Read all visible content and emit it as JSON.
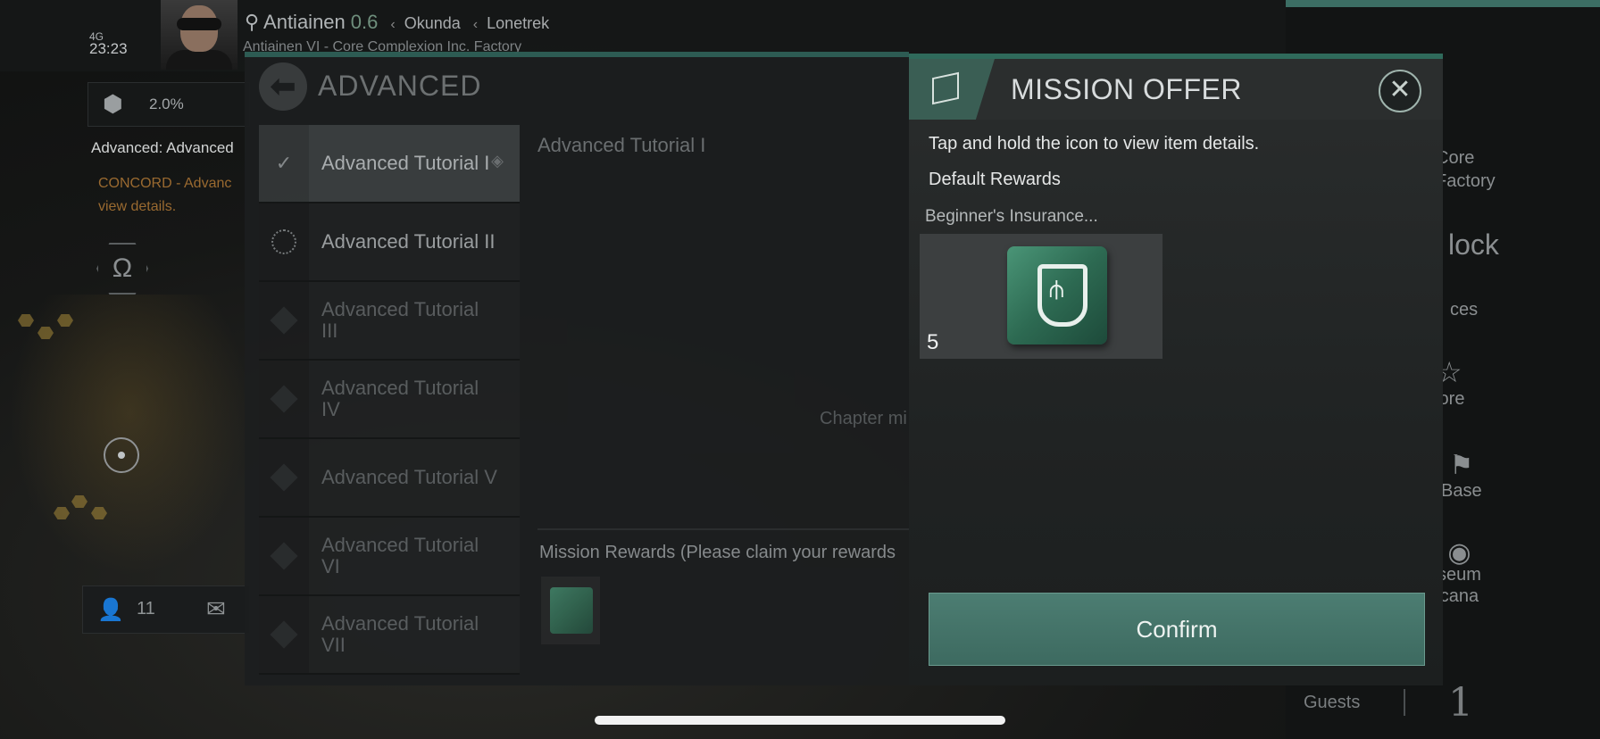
{
  "status": {
    "network": "4G",
    "time": "23:23"
  },
  "location": {
    "system": "Antiainen",
    "security": "0.6",
    "region": "Okunda",
    "constellation": "Lonetrek",
    "station": "Antiainen VI - Core Complexion Inc. Factory"
  },
  "hud": {
    "cargo_percent": "2.0%",
    "mission_text": "Advanced: Advanced",
    "concord_text": "CONCORD - Advanc",
    "concord_sub": "view details.",
    "omega_symbol": "Ω",
    "online_count": "11"
  },
  "right_menu": {
    "core": "Core",
    "factory": "Factory",
    "undock": "lock",
    "services": "ces",
    "store": "tore",
    "base": "Base",
    "museum": "seum",
    "arcana": "cana",
    "guests_label": "Guests",
    "guests_count": "1"
  },
  "advanced": {
    "title": "ADVANCED",
    "items": [
      {
        "label": "Advanced Tutorial I",
        "state": "done"
      },
      {
        "label": "Advanced Tutorial II",
        "state": "next"
      },
      {
        "label": "Advanced Tutorial III",
        "state": "locked"
      },
      {
        "label": "Advanced Tutorial IV",
        "state": "locked"
      },
      {
        "label": "Advanced Tutorial V",
        "state": "locked"
      },
      {
        "label": "Advanced Tutorial VI",
        "state": "locked"
      },
      {
        "label": "Advanced Tutorial VII",
        "state": "locked"
      }
    ],
    "detail_title": "Advanced Tutorial I",
    "chapter_text": "Chapter mi",
    "rewards_label": "Mission Rewards (Please claim your rewards"
  },
  "dialog": {
    "title": "MISSION OFFER",
    "hint": "Tap and hold the icon to view item details.",
    "default_rewards": "Default Rewards",
    "item_name": "Beginner's Insurance...",
    "item_qty": "5",
    "confirm": "Confirm",
    "close_symbol": "✕"
  },
  "colors": {
    "accent": "#3d6a60",
    "topline": "#2f6a5b"
  }
}
